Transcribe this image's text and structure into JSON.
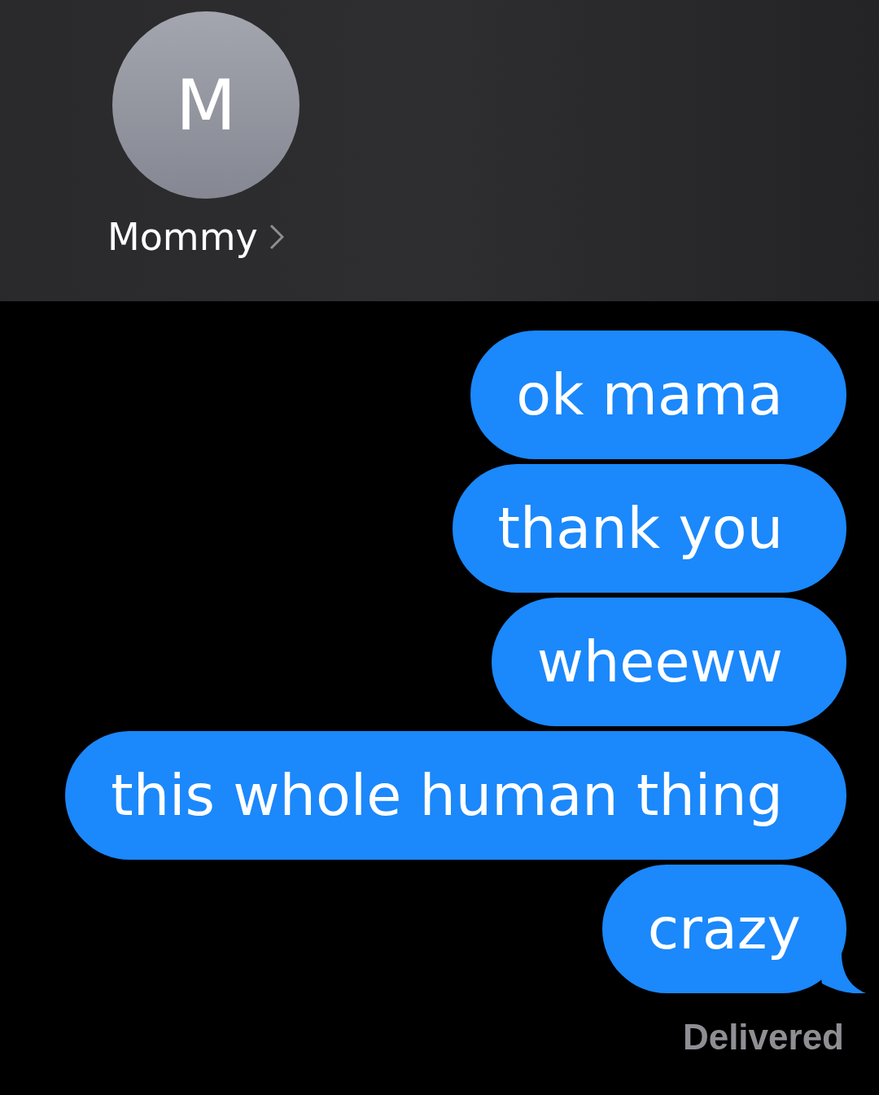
{
  "header": {
    "avatar_initial": "M",
    "contact_name": "Mommy"
  },
  "messages": [
    {
      "text": "ok mama",
      "tail": false
    },
    {
      "text": "thank you",
      "tail": false
    },
    {
      "text": "wheeww",
      "tail": false
    },
    {
      "text": "this whole human thing",
      "tail": false
    },
    {
      "text": "crazy",
      "tail": true
    }
  ],
  "status": "Delivered"
}
